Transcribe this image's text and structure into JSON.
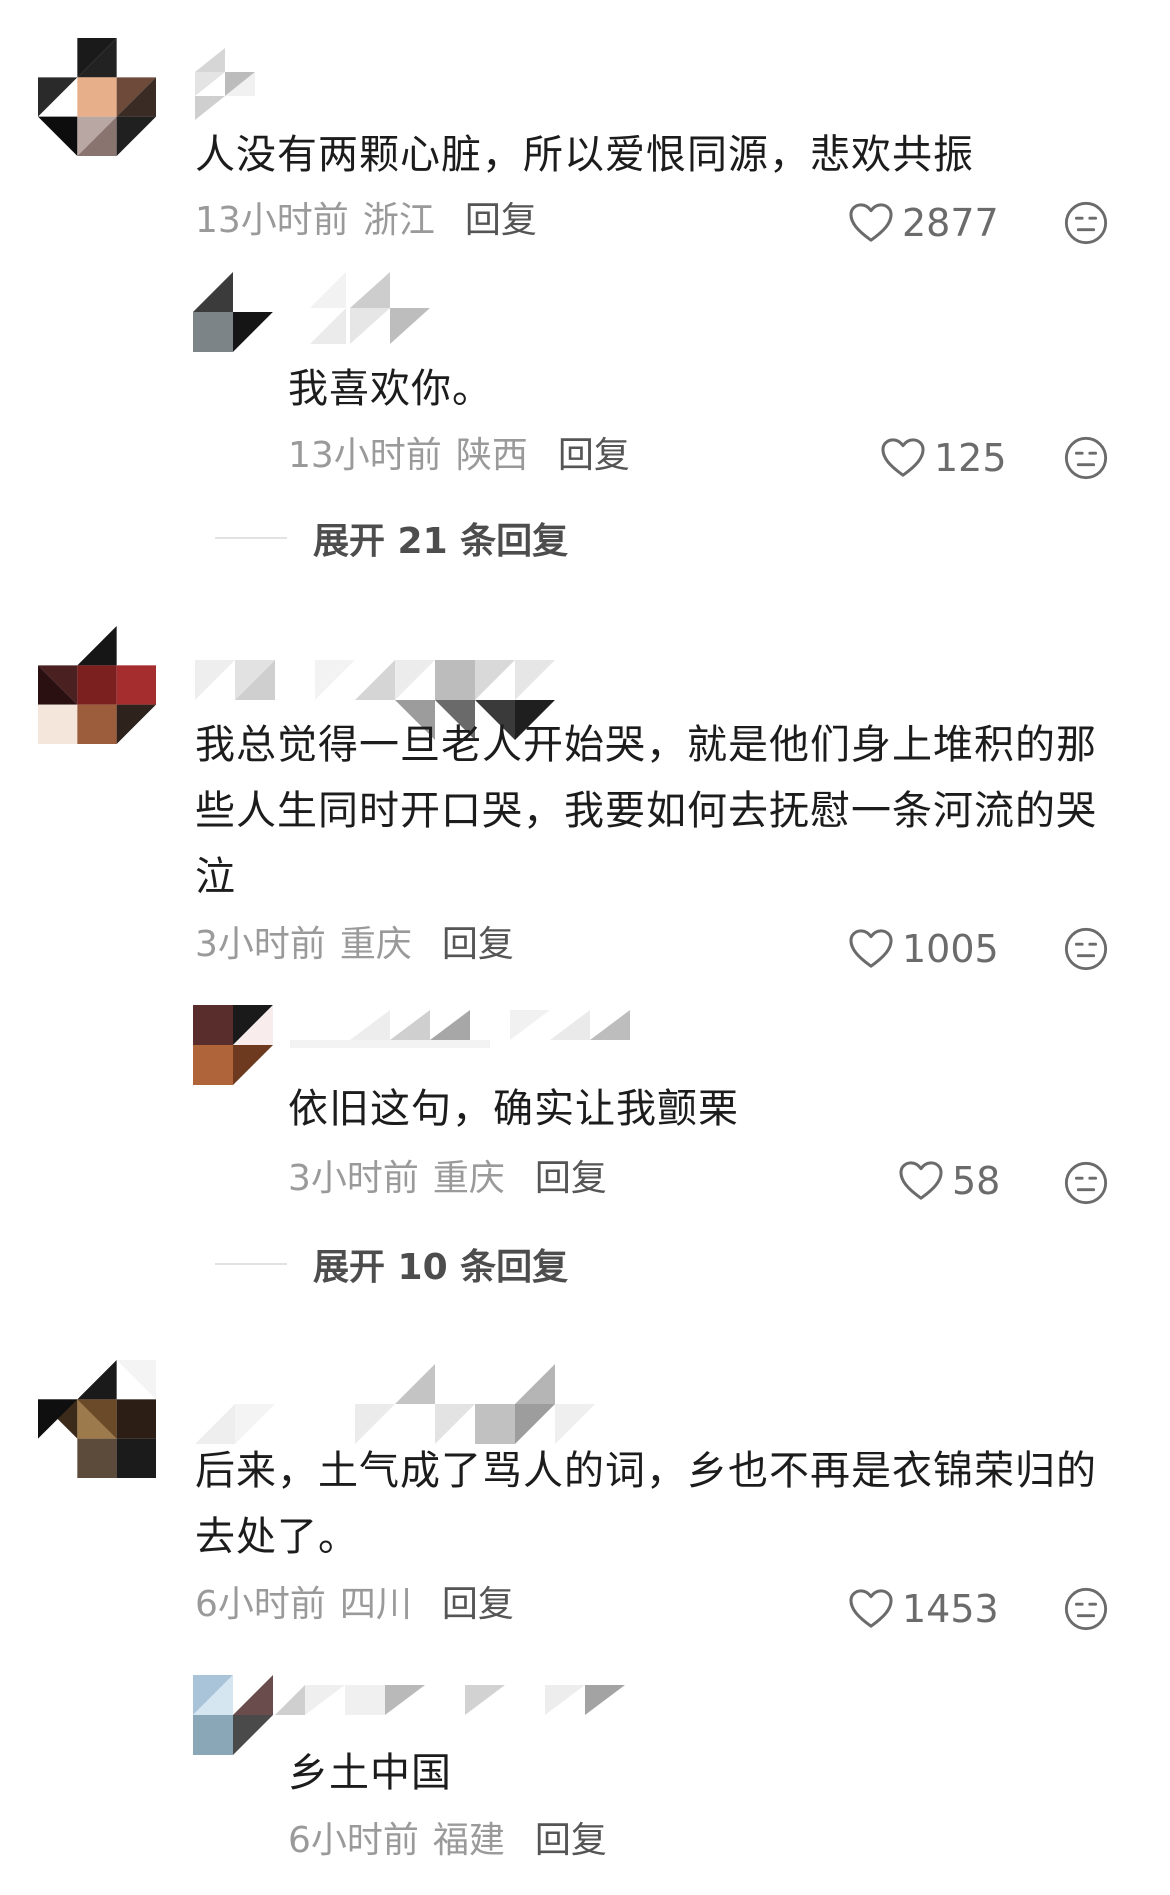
{
  "comments": [
    {
      "text": "人没有两颗心脏，所以爱恨同源，悲欢共振",
      "time": "13小时前",
      "location": "浙江",
      "reply_label": "回复",
      "likes": "2877",
      "reply": {
        "text": "我喜欢你。",
        "time": "13小时前",
        "location": "陕西",
        "reply_label": "回复",
        "likes": "125"
      },
      "expand_label": "展开 21 条回复"
    },
    {
      "text": "我总觉得一旦老人开始哭，就是他们身上堆积的那些人生同时开口哭，我要如何去抚慰一条河流的哭泣",
      "time": "3小时前",
      "location": "重庆",
      "reply_label": "回复",
      "likes": "1005",
      "reply": {
        "text": "依旧这句，确实让我颤栗",
        "time": "3小时前",
        "location": "重庆",
        "reply_label": "回复",
        "likes": "58"
      },
      "expand_label": "展开 10 条回复"
    },
    {
      "text": "后来，土气成了骂人的词，乡也不再是衣锦荣归的去处了。",
      "time": "6小时前",
      "location": "四川",
      "reply_label": "回复",
      "likes": "1453",
      "reply": {
        "text": "乡土中国",
        "time": "6小时前",
        "location": "福建",
        "reply_label": "回复"
      }
    }
  ],
  "icons": {
    "like": "heart-outline-icon",
    "dislike": "meh-face-icon"
  },
  "colors": {
    "text": "#1c1c1c",
    "meta": "#9a9a9a",
    "reply": "#555555"
  }
}
